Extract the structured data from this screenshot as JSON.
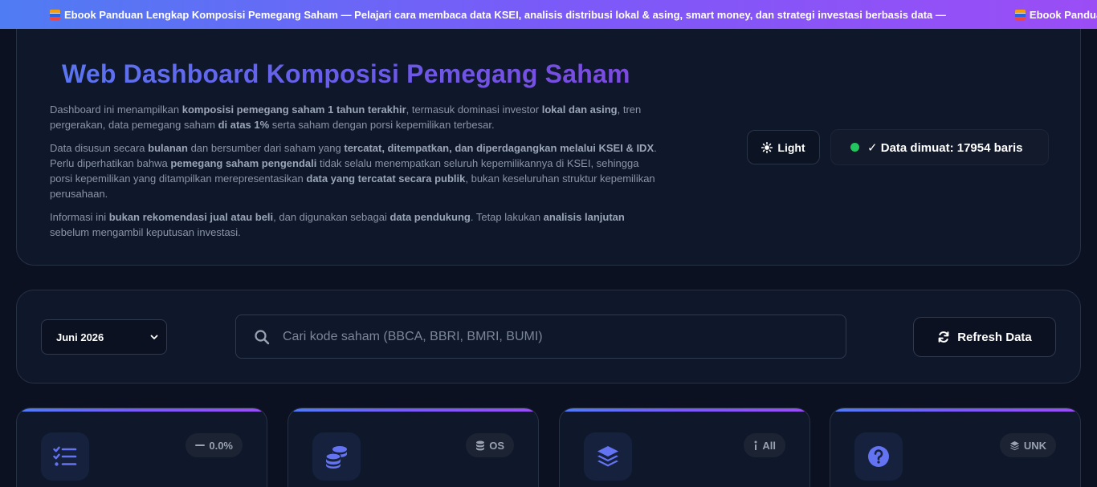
{
  "ticker": {
    "items": [
      "Ebook Panduan Lengkap Komposisi Pemegang Saham — Pelajari cara membaca data KSEI, analisis distribusi lokal & asing, smart money, dan strategi investasi berbasis data —",
      "Ebook Panduan Lengkap K"
    ],
    "icon": "book-icon"
  },
  "hero": {
    "title": "Web Dashboard Komposisi Pemegang Saham",
    "p1": {
      "t1": "Dashboard ini menampilkan ",
      "b1": "komposisi pemegang saham 1 tahun terakhir",
      "t2": ", termasuk dominasi investor ",
      "b2": "lokal dan asing",
      "t3": ", tren pergerakan, data pemegang saham ",
      "b3": "di atas 1%",
      "t4": " serta saham dengan porsi kepemilikan terbesar."
    },
    "p2": {
      "t1": "Data disusun secara ",
      "b1": "bulanan",
      "t2": " dan bersumber dari saham yang ",
      "b2": "tercatat, ditempatkan, dan diperdagangkan melalui KSEI & IDX",
      "t3": ". Perlu diperhatikan bahwa ",
      "b3": "pemegang saham pengendali",
      "t4": " tidak selalu menempatkan seluruh kepemilikannya di KSEI, sehingga porsi kepemilikan yang ditampilkan merepresentasikan ",
      "b4": "data yang tercatat secara publik",
      "t5": ", bukan keseluruhan struktur kepemilikan perusahaan."
    },
    "p3": {
      "t1": "Informasi ini ",
      "b1": "bukan rekomendasi jual atau beli",
      "t2": ", dan digunakan sebagai ",
      "b2": "data pendukung",
      "t3": ". Tetap lakukan ",
      "b3": "analisis lanjutan",
      "t4": " sebelum mengambil keputusan investasi."
    },
    "theme_label": "Light",
    "theme_icon": "sun-icon",
    "status_text": "✓ Data dimuat: 17954 baris",
    "status_color": "#22c55e"
  },
  "controls": {
    "month_selected": "Juni 2026",
    "search_placeholder": "Cari kode saham (BBCA, BBRI, BMRI, BUMI)",
    "search_value": "",
    "refresh_label": "Refresh Data"
  },
  "cards": [
    {
      "icon": "list-check-icon",
      "badge_icon": "dash-icon",
      "badge": "0.0%"
    },
    {
      "icon": "coins-icon",
      "badge_icon": "database-icon",
      "badge": "OS"
    },
    {
      "icon": "layers-icon",
      "badge_icon": "info-icon",
      "badge": "All"
    },
    {
      "icon": "question-icon",
      "badge_icon": "layers-small-icon",
      "badge": "UNK"
    }
  ],
  "colors": {
    "accent_blue": "#4f7cf3",
    "accent_purple": "#9b4df5",
    "icon_blue": "#6373f2"
  }
}
